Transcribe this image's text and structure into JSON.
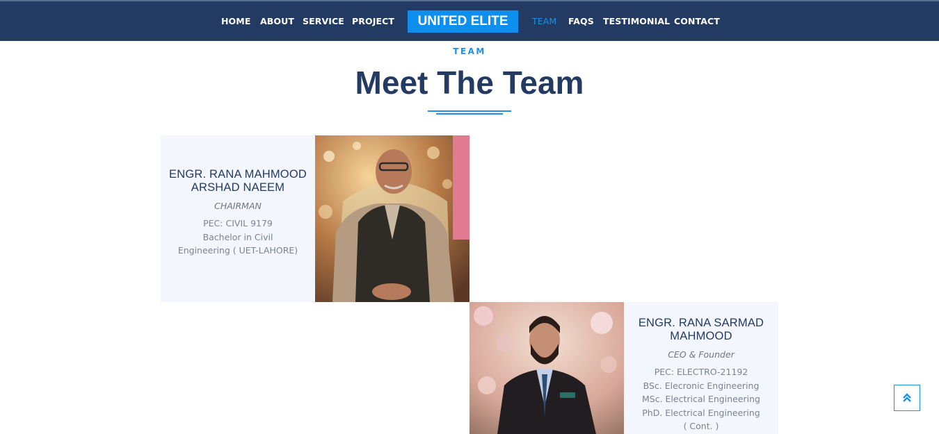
{
  "nav": {
    "items": [
      "HOME",
      "ABOUT",
      "SERVICE",
      "PROJECT"
    ],
    "items_right": [
      "TEAM",
      "FAQS",
      "TESTIMONIAL",
      "CONTACT"
    ],
    "brand": "UNITED ELITE",
    "active": "TEAM"
  },
  "section": {
    "eyebrow": "TEAM",
    "title": "Meet The Team"
  },
  "members": [
    {
      "name_line1": "ENGR. RANA MAHMOOD",
      "name_line2": "ARSHAD NAEEM",
      "role": "CHAIRMAN",
      "details": [
        "PEC: CIVIL 9179",
        "Bachelor in Civil",
        "Engineering ( UET-LAHORE)"
      ]
    },
    {
      "name_line1": "ENGR. RANA SARMAD",
      "name_line2": "MAHMOOD",
      "role": "CEO & Founder",
      "details": [
        "PEC: ELECTRO-21192",
        "BSc. Elecronic Engineering",
        "MSc. Electrical Engineering",
        "PhD. Electrical Engineering",
        "( Cont. )"
      ]
    }
  ],
  "colors": {
    "nav_bg": "#233a63",
    "accent": "#1e90e8",
    "brand_bg": "#0d8ff0",
    "card_bg": "#f3f6fc"
  },
  "icons": {
    "scroll_top": "double-chevron-up-icon"
  }
}
